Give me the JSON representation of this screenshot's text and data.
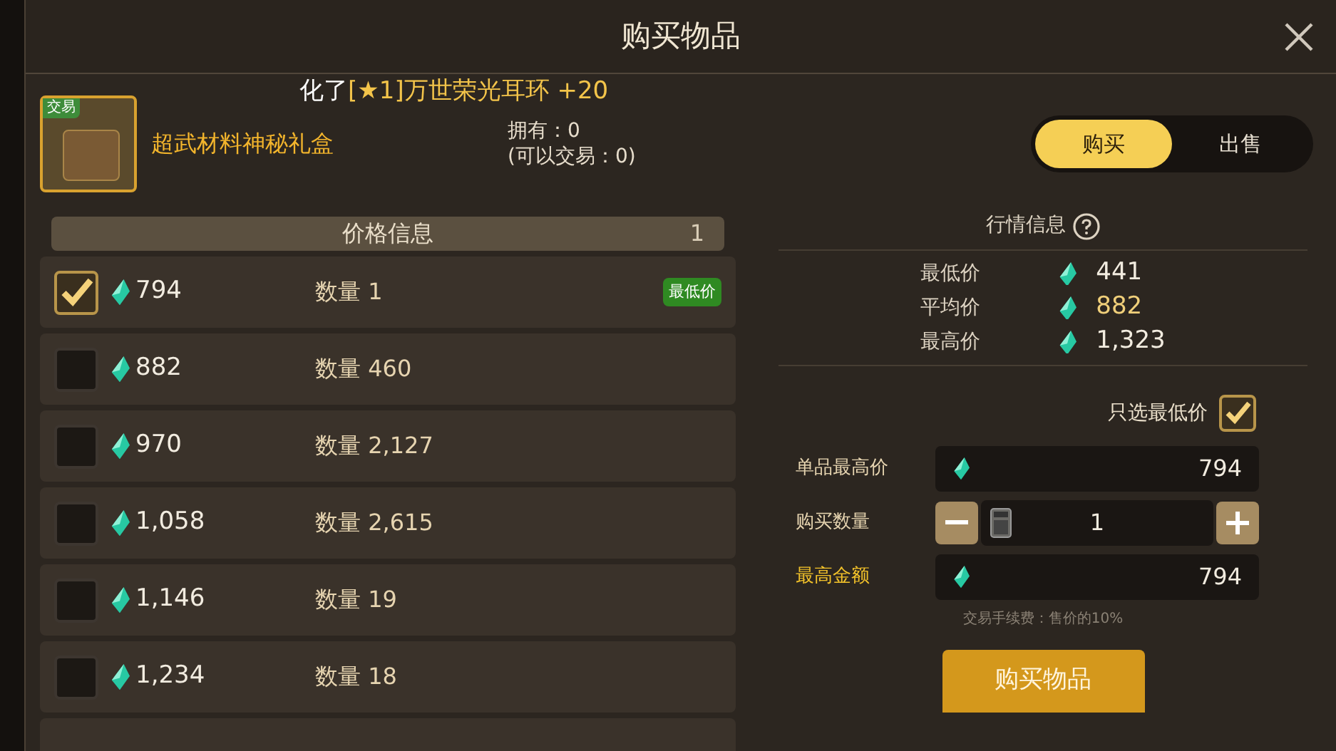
{
  "window": {
    "title": "购买物品"
  },
  "ticker": {
    "prefix": "化了",
    "highlight": "[★1]万世荣光耳环 +20"
  },
  "item": {
    "badge": "交易",
    "name": "超武材料神秘礼盒",
    "owned": "拥有：0",
    "tradable": "(可以交易：0)"
  },
  "mode_tabs": [
    {
      "label": "购买",
      "selected": true
    },
    {
      "label": "出售",
      "selected": false
    }
  ],
  "price_list": {
    "title": "价格信息",
    "count": "1",
    "rows": [
      {
        "price": "794",
        "quantity": "数量 1",
        "checked": true,
        "badge": "最低价"
      },
      {
        "price": "882",
        "quantity": "数量 460",
        "checked": false
      },
      {
        "price": "970",
        "quantity": "数量 2,127",
        "checked": false
      },
      {
        "price": "1,058",
        "quantity": "数量 2,615",
        "checked": false
      },
      {
        "price": "1,146",
        "quantity": "数量 19",
        "checked": false
      },
      {
        "price": "1,234",
        "quantity": "数量 18",
        "checked": false
      }
    ]
  },
  "market": {
    "title": "行情信息",
    "stats": [
      {
        "label": "最低价",
        "value": "441",
        "highlighted": false
      },
      {
        "label": "平均价",
        "value": "882",
        "highlighted": true
      },
      {
        "label": "最高价",
        "value": "1,323",
        "highlighted": false
      }
    ]
  },
  "lowest_only": {
    "label": "只选最低价",
    "checked": true
  },
  "form": {
    "max_unit_price_label": "单品最高价",
    "max_unit_price": "794",
    "quantity_label": "购买数量",
    "quantity": "1",
    "max_total_label": "最高金额",
    "max_total": "794"
  },
  "fee_note": "交易手续费：售价的10%",
  "buy_button": "购买物品"
}
